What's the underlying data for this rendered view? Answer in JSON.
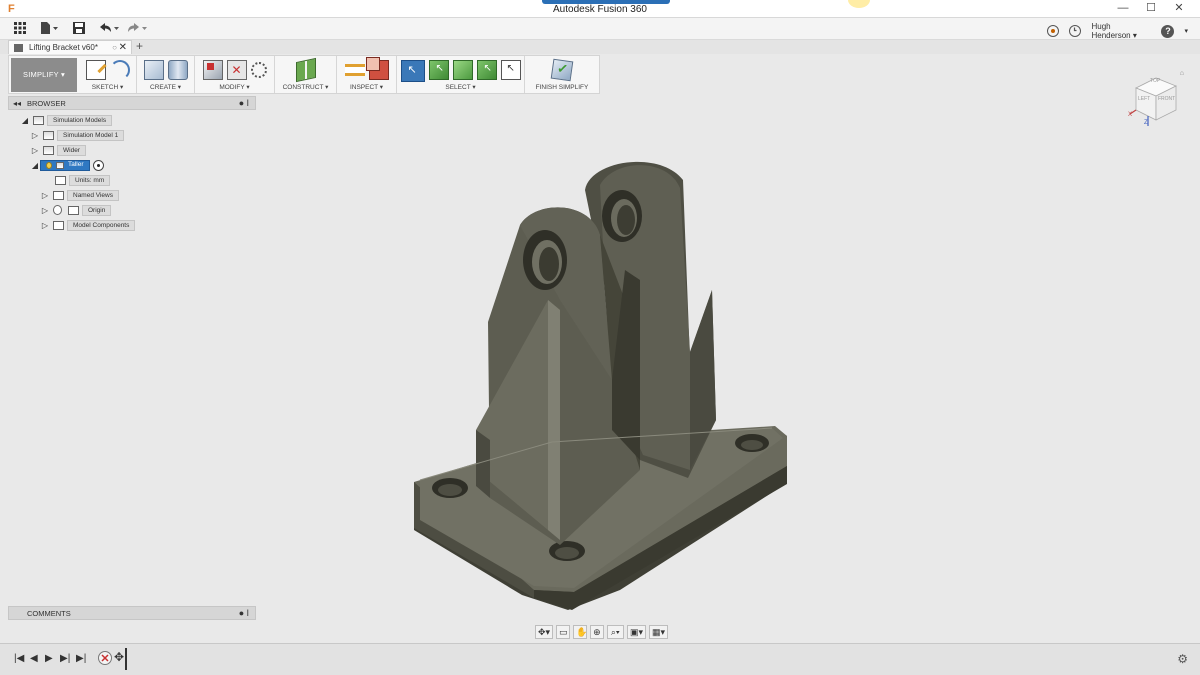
{
  "window": {
    "title": "Autodesk Fusion 360",
    "controls": [
      "—",
      "☐",
      "✕"
    ]
  },
  "app_toolbar": {
    "grid_icon": "apps-grid-icon",
    "file_icon": "file-icon",
    "save_icon": "save-icon",
    "undo_icon": "undo-icon",
    "redo_icon": "redo-icon",
    "user_name": "Hugh Henderson ▾",
    "help_label": "?"
  },
  "document_tab": {
    "title": "Lifting Bracket v60*",
    "close": "✕",
    "add": "+"
  },
  "ribbon": {
    "workspace": "SIMPLIFY ▾",
    "groups": [
      {
        "label": "SKETCH ▾"
      },
      {
        "label": "CREATE ▾"
      },
      {
        "label": "MODIFY ▾"
      },
      {
        "label": "CONSTRUCT ▾"
      },
      {
        "label": "INSPECT ▾"
      },
      {
        "label": "SELECT ▾"
      },
      {
        "label": "FINISH SIMPLIFY"
      }
    ]
  },
  "browser": {
    "title": "BROWSER",
    "items": [
      {
        "label": "Simulation Models",
        "level": 0,
        "expanded": true
      },
      {
        "label": "Simulation Model 1",
        "level": 1,
        "expanded": false
      },
      {
        "label": "Wider",
        "level": 1,
        "expanded": false
      },
      {
        "label": "Taller",
        "level": 1,
        "expanded": true,
        "selected": true
      },
      {
        "label": "Units: mm",
        "level": 2
      },
      {
        "label": "Named Views",
        "level": 2,
        "expanded": false
      },
      {
        "label": "Origin",
        "level": 2,
        "expanded": false
      },
      {
        "label": "Model Components",
        "level": 2,
        "expanded": false
      }
    ]
  },
  "comments": {
    "title": "COMMENTS"
  },
  "viewcube": {
    "top": "TOP",
    "left": "LEFT",
    "front": "FRONT",
    "axis_x": "X",
    "axis_z": "Z"
  },
  "colors": {
    "part": "#5b5b4e",
    "part_light": "#6d6d60",
    "part_dark": "#3f3f35",
    "select_blue": "#2f78c2",
    "background": "#e9e9e9"
  }
}
